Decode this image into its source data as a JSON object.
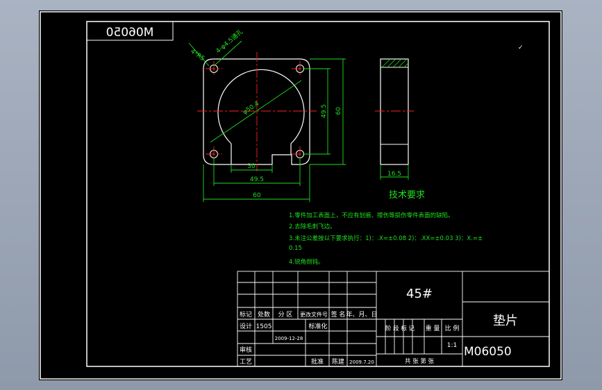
{
  "drawing_code_top": "M06050",
  "tech_title": "技术要求",
  "tech_notes": [
    "1.零件加工表面上，不应有划痕、擦伤等损伤零件表面的缺陷。",
    "2.去除毛刺飞边。",
    "3.未注公差按以下要求执行：1)：.X=±0.08    2)：.XX=±0.03    3)：X.=±",
    "0.15",
    "4.锐角倒钝。"
  ],
  "dimensions": {
    "hole_dia": "4-φ4.5通孔",
    "corner_radius": "4*R5",
    "bore_dia": "φ50.4",
    "slot_width": "30",
    "hole_pitch_x": "49.5",
    "overall_width": "60",
    "hole_pitch_y": "49.5",
    "overall_height": "60",
    "thickness": "16.5"
  },
  "title_block": {
    "material": "45#",
    "part_name": "垫片",
    "drawing_no": "M06050",
    "scale": "1:1",
    "col_mark": "标记",
    "col_count": "处数",
    "col_zone": "分 区",
    "col_doc": "更改文件号",
    "col_sign": "签 名",
    "col_date": "年、月、日",
    "design": "设计",
    "designer": "1505",
    "design_date": "2009-12-28",
    "standardize": "标准化",
    "stage_mark": "阶 段 标 记",
    "weight": "重 量",
    "ratio": "比 例",
    "review": "审核",
    "process": "工艺",
    "approve": "批准",
    "approver": "陈建",
    "approve_date": "2009.7.20",
    "sheets": "共     张  第     张"
  }
}
